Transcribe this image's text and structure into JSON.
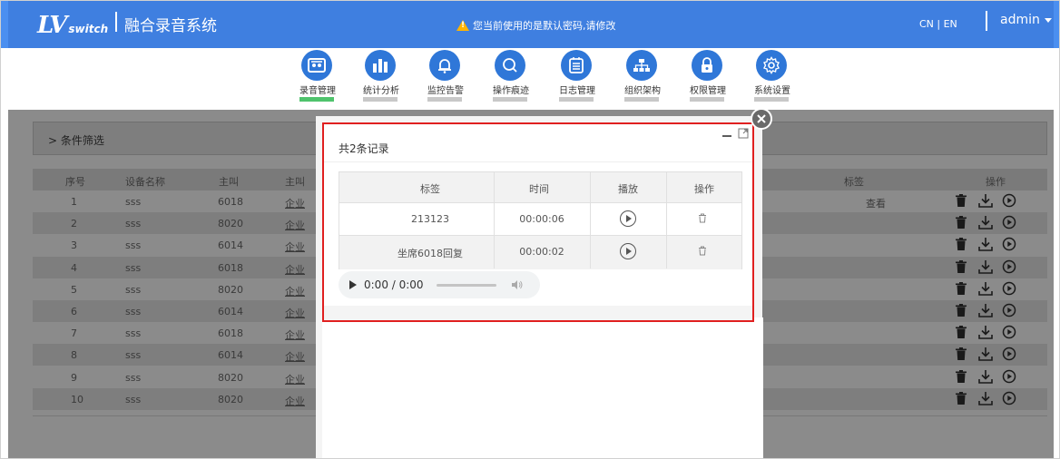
{
  "header": {
    "logo_main": "LV",
    "logo_sub": "switch",
    "app_title": "融合录音系统",
    "warning": "您当前使用的是默认密码,请修改",
    "lang": "CN | EN",
    "user": "admin"
  },
  "nav": [
    {
      "label": "录音管理",
      "icon": "tape-icon",
      "active": true
    },
    {
      "label": "统计分析",
      "icon": "bar-chart-icon",
      "active": false
    },
    {
      "label": "监控告警",
      "icon": "bell-icon",
      "active": false
    },
    {
      "label": "操作痕迹",
      "icon": "search-icon",
      "active": false
    },
    {
      "label": "日志管理",
      "icon": "calendar-icon",
      "active": false
    },
    {
      "label": "组织架构",
      "icon": "org-chart-icon",
      "active": false
    },
    {
      "label": "权限管理",
      "icon": "lock-icon",
      "active": false
    },
    {
      "label": "系统设置",
      "icon": "gear-icon",
      "active": false
    }
  ],
  "filter": {
    "label": "> 条件筛选"
  },
  "table": {
    "headers": {
      "index": "序号",
      "device": "设备名称",
      "caller": "主叫",
      "caller2": "主叫",
      "tag": "标签",
      "ops": "操作"
    },
    "rows": [
      {
        "index": "1",
        "device": "sss",
        "caller": "6018",
        "caller2": "企业",
        "tag": "查看"
      },
      {
        "index": "2",
        "device": "sss",
        "caller": "8020",
        "caller2": "企业",
        "tag": ""
      },
      {
        "index": "3",
        "device": "sss",
        "caller": "6014",
        "caller2": "企业",
        "tag": ""
      },
      {
        "index": "4",
        "device": "sss",
        "caller": "6018",
        "caller2": "企业",
        "tag": ""
      },
      {
        "index": "5",
        "device": "sss",
        "caller": "8020",
        "caller2": "企业",
        "tag": ""
      },
      {
        "index": "6",
        "device": "sss",
        "caller": "6014",
        "caller2": "企业",
        "tag": ""
      },
      {
        "index": "7",
        "device": "sss",
        "caller": "6018",
        "caller2": "企业",
        "tag": ""
      },
      {
        "index": "8",
        "device": "sss",
        "caller": "6014",
        "caller2": "企业",
        "tag": ""
      },
      {
        "index": "9",
        "device": "sss",
        "caller": "8020",
        "caller2": "企业",
        "tag": ""
      },
      {
        "index": "10",
        "device": "sss",
        "caller": "8020",
        "caller2": "企业",
        "tag": ""
      }
    ]
  },
  "modal": {
    "title": "共2条记录",
    "headers": {
      "tag": "标签",
      "time": "时间",
      "play": "播放",
      "ops": "操作"
    },
    "records": [
      {
        "tag": "213123",
        "time": "00:00:06"
      },
      {
        "tag": "坐席6018回复",
        "time": "00:00:02"
      }
    ],
    "audio_time": "0:00 / 0:00"
  },
  "colors": {
    "header": "#3f7fe0",
    "nav_icon": "#2f77d8",
    "active_bar": "#4fc36c",
    "highlight": "#e02020"
  }
}
